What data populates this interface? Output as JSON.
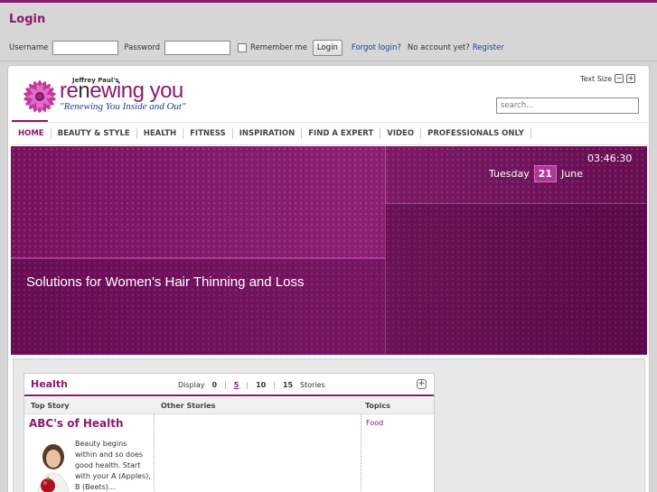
{
  "login": {
    "title": "Login",
    "username_label": "Username",
    "password_label": "Password",
    "remember_label": "Remember me",
    "login_button": "Login",
    "forgot_link": "Forgot login?",
    "no_account_text": "No account yet?",
    "register_link": "Register"
  },
  "brand": {
    "small": "Jeffrey Paul's",
    "name_pre": "re",
    "name_n": "n",
    "name_post": "ewing you",
    "tagline": "\"Renewing You Inside and Out\""
  },
  "header": {
    "text_size_label": "Text Size",
    "text_size_minus": "−",
    "text_size_plus": "+",
    "search_placeholder": "search..."
  },
  "nav": {
    "items": [
      "HOME",
      "BEAUTY & STYLE",
      "HEALTH",
      "FITNESS",
      "INSPIRATION",
      "FIND A EXPERT",
      "VIDEO",
      "PROFESSIONALS ONLY"
    ]
  },
  "hero": {
    "time": "03:46:30",
    "weekday": "Tuesday",
    "day": "21",
    "month": "June",
    "headline": "Solutions for Women's Hair Thinning and Loss"
  },
  "health_box": {
    "title": "Health",
    "display_label": "Display",
    "options": [
      "0",
      "5",
      "10",
      "15"
    ],
    "stories_label": "Stories",
    "expand": "+",
    "col_top": "Top Story",
    "col_other": "Other Stories",
    "col_topics": "Topics",
    "story_title": "ABC's of Health",
    "story_text": "Beauty begins within and so does good health. Start with your A (Apples), B (Beets)...",
    "topic": "Food"
  },
  "colors": {
    "accent": "#8a1a6e",
    "link": "#1b3f9b"
  }
}
